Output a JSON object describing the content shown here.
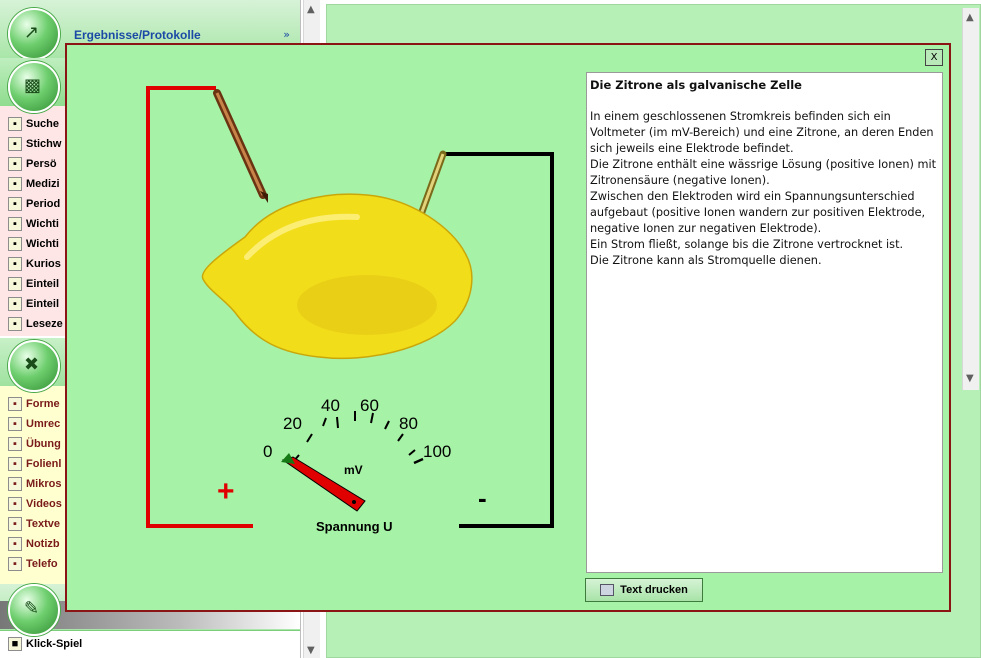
{
  "sidebar": {
    "header1_title": "Ergebnisse/Protokolle",
    "section2_items": [
      {
        "label": "Suche",
        "icon": "search-icon"
      },
      {
        "label": "Stichw",
        "icon": "book-icon"
      },
      {
        "label": "Persö",
        "icon": "person-icon"
      },
      {
        "label": "Medizi",
        "icon": "open-book-icon"
      },
      {
        "label": "Period",
        "icon": "atom-icon"
      },
      {
        "label": "Wichti",
        "icon": "info-icon"
      },
      {
        "label": "Wichti",
        "icon": "info-icon"
      },
      {
        "label": "Kurios",
        "icon": "info-icon"
      },
      {
        "label": "Einteil",
        "icon": "info-icon"
      },
      {
        "label": "Einteil",
        "icon": "info-icon"
      },
      {
        "label": "Leseze",
        "icon": "bookmark-icon"
      }
    ],
    "section3_items": [
      {
        "label": "Forme",
        "icon": "formula-icon"
      },
      {
        "label": "Umrec",
        "icon": "table-icon"
      },
      {
        "label": "Übung",
        "icon": "pencil-icon"
      },
      {
        "label": "Folienl",
        "icon": "slides-icon"
      },
      {
        "label": "Mikros",
        "icon": "slides-icon"
      },
      {
        "label": "Videos",
        "icon": "video-icon"
      },
      {
        "label": "Textve",
        "icon": "text-icon"
      },
      {
        "label": "Notizb",
        "icon": "notebook-icon"
      },
      {
        "label": "Telefo",
        "icon": "phone-icon"
      }
    ],
    "bottom_item": {
      "label": "Klick-Spiel",
      "icon": "game-icon"
    }
  },
  "modal": {
    "close_label": "X",
    "article_title": "Die Zitrone als galvanische Zelle",
    "article_lines": [
      "In einem geschlossenen Stromkreis befinden sich ein",
      "Voltmeter (im mV-Bereich) und eine Zitrone, an deren Enden",
      "sich jeweils eine Elektrode befindet.",
      "Die Zitrone enthält eine wässrige Lösung (positive Ionen) mit",
      "Zitronensäure (negative Ionen).",
      "Zwischen den Elektroden wird ein Spannungsunterschied",
      "aufgebaut (positive Ionen wandern zur positiven Elektrode,",
      "negative Ionen zur negativen Elektrode).",
      "Ein Strom fließt, solange bis die Zitrone vertrocknet ist.",
      "Die Zitrone kann als Stromquelle dienen."
    ],
    "print_button_label": "Text drucken",
    "illustration": {
      "meter_ticks": [
        "0",
        "20",
        "40",
        "60",
        "80",
        "100"
      ],
      "meter_unit": "mV",
      "meter_caption": "Spannung U",
      "plus_sign": "+",
      "minus_sign": "-"
    }
  },
  "colors": {
    "modal_bg": "#a6f2a6",
    "modal_border": "#8b1414",
    "wire_positive": "#e00000",
    "wire_negative": "#000000",
    "lemon": "#f2dd1a"
  }
}
